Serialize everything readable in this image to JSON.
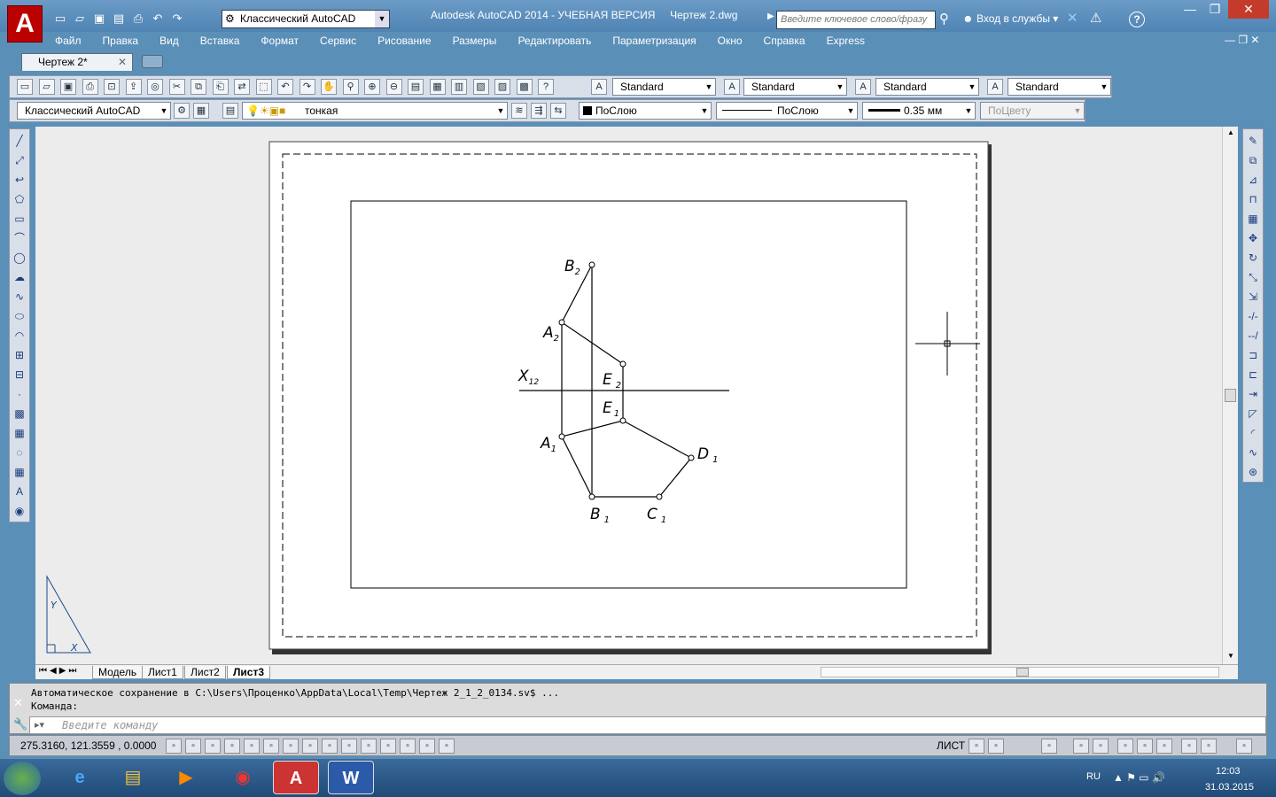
{
  "window": {
    "title": "Autodesk AutoCAD 2014 - УЧЕБНАЯ ВЕРСИЯ",
    "document_name": "Чертеж 2.dwg",
    "app_logo": "A",
    "workspace": "Классический AutoCAD",
    "search_placeholder": "Введите ключевое слово/фразу",
    "login": "Вход в службы",
    "help_icon": "?"
  },
  "menu": [
    "Файл",
    "Правка",
    "Вид",
    "Вставка",
    "Формат",
    "Сервис",
    "Рисование",
    "Размеры",
    "Редактировать",
    "Параметризация",
    "Окно",
    "Справка",
    "Express"
  ],
  "doc_tab": {
    "label": "Чертеж 2*",
    "close": "✕"
  },
  "styles_toolbar": {
    "text_style": "Standard",
    "dim_style": "Standard",
    "table_style": "Standard",
    "mleader_style": "Standard"
  },
  "layers_toolbar": {
    "workspace": "Классический AutoCAD",
    "layer": "тонкая",
    "color": "ПоСлою",
    "linetype": "ПоСлою",
    "lineweight": "0.35 мм",
    "plotstyle": "ПоЦвету"
  },
  "drawing": {
    "labels": {
      "B2": "B",
      "B2sub": "2",
      "A2": "A",
      "A2sub": "2",
      "X12": "X",
      "X12sub": "12",
      "E2": "E",
      "E2sub": "2",
      "E1": "E",
      "E1sub": "1",
      "A1": "A",
      "A1sub": "1",
      "D1": "D",
      "D1sub": "1",
      "B1": "B",
      "B1sub": "1",
      "C1": "C",
      "C1sub": "1"
    },
    "ucs_y": "Y",
    "ucs_x": "X"
  },
  "layout_tabs": [
    "Модель",
    "Лист1",
    "Лист2",
    "Лист3"
  ],
  "active_layout": "Лист3",
  "command": {
    "history_line1": "Автоматическое сохранение в C:\\Users\\Проценко\\AppData\\Local\\Temp\\Чертеж 2_1_2_0134.sv$ ...",
    "history_line2": "Команда:",
    "input_placeholder": "Введите команду"
  },
  "status": {
    "coordinates": "275.3160, 121.3559 , 0.0000",
    "space": "ЛИСТ"
  },
  "taskbar": {
    "lang": "RU",
    "time": "12:03",
    "date": "31.03.2015"
  },
  "colors": {
    "title_bar": "#4f84b4",
    "app_red": "#b00000",
    "canvas_bg": "#ececec",
    "paper": "#ffffff"
  }
}
